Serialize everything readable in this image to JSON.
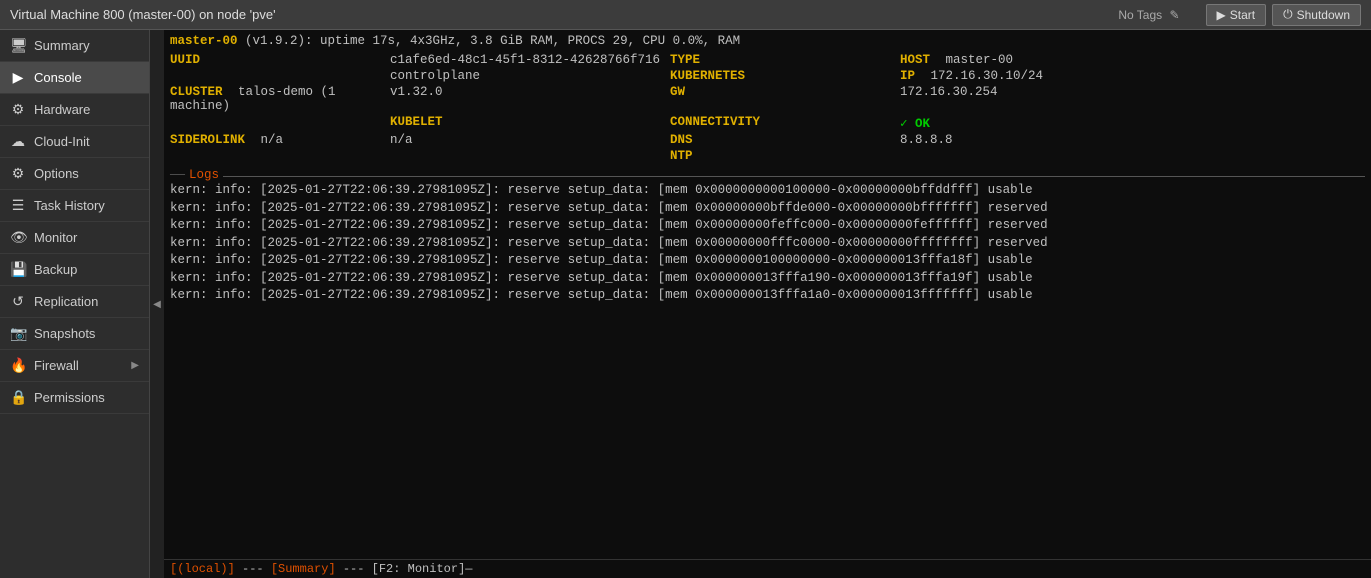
{
  "topbar": {
    "title": "Virtual Machine 800 (master-00) on node 'pve'",
    "tags_label": "No Tags",
    "start_label": "Start",
    "shutdown_label": "Shutdown"
  },
  "sidebar": {
    "items": [
      {
        "id": "summary",
        "label": "Summary",
        "icon": "🖥"
      },
      {
        "id": "console",
        "label": "Console",
        "icon": ">"
      },
      {
        "id": "hardware",
        "label": "Hardware",
        "icon": "⚙"
      },
      {
        "id": "cloud-init",
        "label": "Cloud-Init",
        "icon": "☁"
      },
      {
        "id": "options",
        "label": "Options",
        "icon": "⚙"
      },
      {
        "id": "task-history",
        "label": "Task History",
        "icon": "☰"
      },
      {
        "id": "monitor",
        "label": "Monitor",
        "icon": "👁"
      },
      {
        "id": "backup",
        "label": "Backup",
        "icon": "💾"
      },
      {
        "id": "replication",
        "label": "Replication",
        "icon": "↺"
      },
      {
        "id": "snapshots",
        "label": "Snapshots",
        "icon": "📷"
      },
      {
        "id": "firewall",
        "label": "Firewall",
        "icon": "🔥"
      },
      {
        "id": "permissions",
        "label": "Permissions",
        "icon": "🔒"
      }
    ]
  },
  "terminal": {
    "header_line": "master-00 (v1.9.2): uptime 17s, 4x3GHz, 3.8 GiB RAM, PROCS 29, CPU 0.0%, RAM",
    "uuid_key": "UUID",
    "uuid_val": "c1afe6ed-48c1-45f1-8312-42628766f716",
    "type_key": "TYPE",
    "type_val": "controlplane",
    "host_key": "HOST",
    "host_val": "master-00",
    "kubernetes_key": "KUBERNETES",
    "kubernetes_val": "v1.32.0",
    "ip_key": "IP",
    "ip_val": "172.16.30.10/24",
    "cluster_key": "CLUSTER",
    "cluster_val": "talos-demo (1 machine)",
    "gw_key": "GW",
    "gw_val": "172.16.30.254",
    "kubelet_key": "KUBELET",
    "kubelet_val": "n/a",
    "connectivity_key": "CONNECTIVITY",
    "connectivity_val": "✓ OK",
    "siderolink_key": "SIDEROLINK",
    "siderolink_val": "n/a",
    "dns_key": "DNS",
    "dns_val": "8.8.8.8",
    "ntp_key": "NTP",
    "ntp_val": "",
    "logs_label": "Logs",
    "log_lines": [
      "kern:     info: [2025-01-27T22:06:39.27981095Z]: reserve setup_data: [mem 0x0000000000100000-0x00000000bffddfff] usable",
      "kern:     info: [2025-01-27T22:06:39.27981095Z]: reserve setup_data: [mem 0x00000000bffde000-0x00000000bfffffff] reserved",
      "kern:     info: [2025-01-27T22:06:39.27981095Z]: reserve setup_data: [mem 0x00000000feffc000-0x00000000feffffff] reserved",
      "kern:     info: [2025-01-27T22:06:39.27981095Z]: reserve setup_data: [mem 0x00000000fffc0000-0x00000000ffffffff] reserved",
      "kern:     info: [2025-01-27T22:06:39.27981095Z]: reserve setup_data: [mem 0x0000000100000000-0x000000013fffa18f] usable",
      "kern:     info: [2025-01-27T22:06:39.27981095Z]: reserve setup_data: [mem 0x000000013fffa190-0x000000013fffa19f] usable",
      "kern:     info: [2025-01-27T22:06:39.27981095Z]: reserve setup_data: [mem 0x000000013fffa1a0-0x000000013fffffff] usable"
    ],
    "statusbar": "[(local)] --- [Summary] --- [F2: Monitor]—"
  }
}
